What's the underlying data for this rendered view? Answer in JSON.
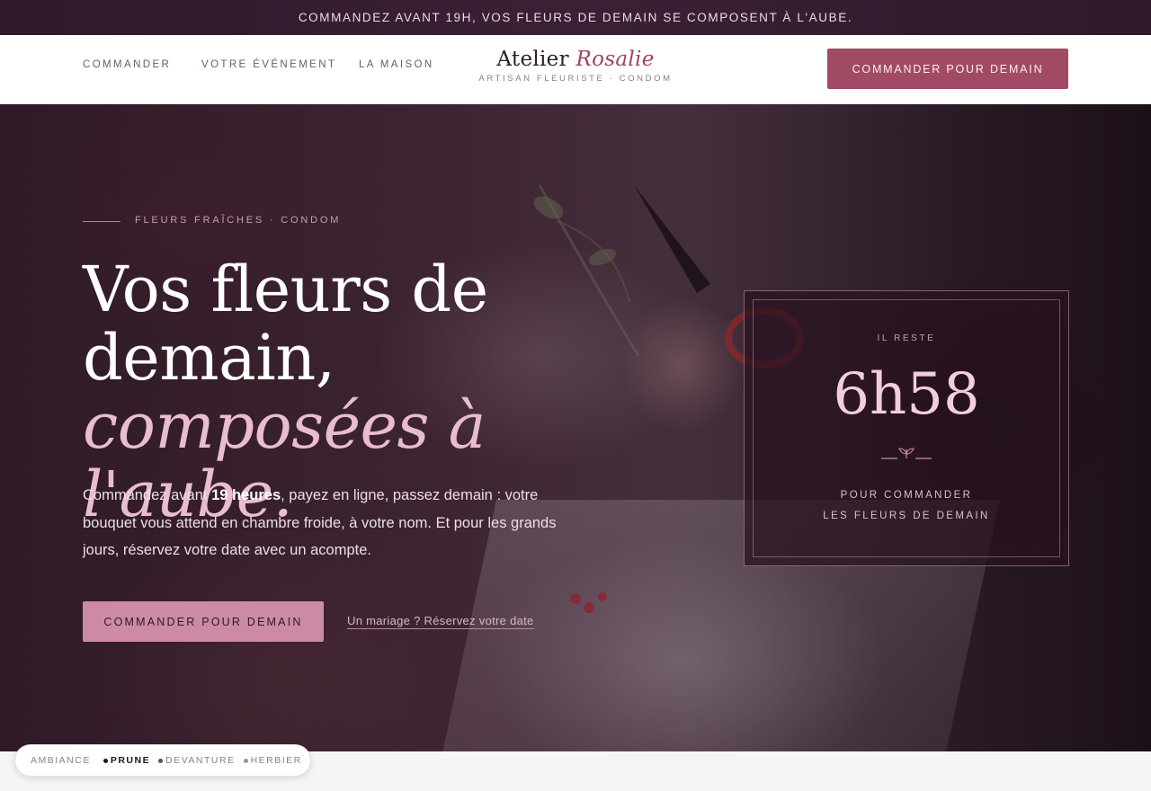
{
  "announcement": "COMMANDEZ AVANT 19H, VOS FLEURS DE DEMAIN SE COMPOSENT À L'AUBE.",
  "nav": {
    "items": [
      "COMMANDER",
      "VOTRE ÉVÉNEMENT",
      "LA MAISON"
    ]
  },
  "logo": {
    "name_first": "Atelier",
    "name_second": "Rosalie",
    "tagline": "ARTISAN FLEURISTE · CONDOM"
  },
  "header_cta": "COMMANDER POUR DEMAIN",
  "hero": {
    "eyebrow": "FLEURS FRAÎCHES · CONDOM",
    "title_line1": "Vos fleurs de",
    "title_line2": "demain,",
    "title_accent": "composées à l'aube.",
    "lede_before": "Commandez avant ",
    "lede_bold": "19 heures",
    "lede_after": ", payez en ligne, passez demain : votre bouquet vous attend en chambre froide, à votre nom. Et pour les grands jours, réservez votre date avec un acompte.",
    "primary_cta": "COMMANDER POUR DEMAIN",
    "secondary_link": "Un mariage ? Réservez votre date"
  },
  "countdown": {
    "label": "IL RESTE",
    "time": "6h58",
    "sub_line1": "POUR COMMANDER",
    "sub_line2": "LES FLEURS DE DEMAIN"
  },
  "ambiance": {
    "title": "AMBIANCE",
    "options": [
      "PRUNE",
      "DEVANTURE",
      "HERBIER"
    ],
    "active": "PRUNE"
  },
  "colors": {
    "announce_bg": "#3b2035",
    "brand": "#a14a64",
    "accent_pink": "#e9bcd1",
    "hero_button": "#cc8aa6"
  },
  "icons": {
    "sprig": "sprig-icon",
    "dot": "dot-icon"
  }
}
